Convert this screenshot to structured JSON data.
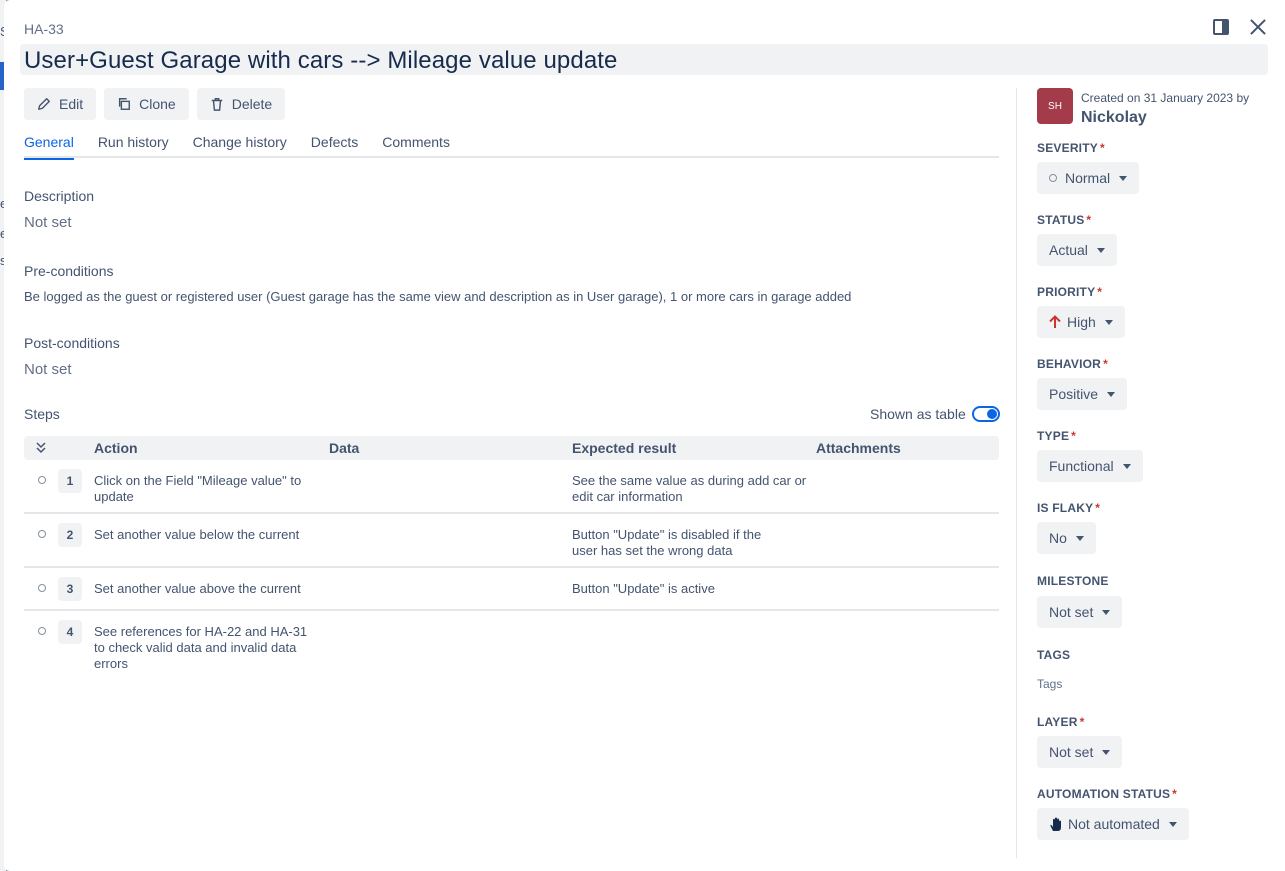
{
  "background": {
    "letters": [
      "S",
      "e",
      "e",
      "s"
    ]
  },
  "issue": {
    "key": "HA-33",
    "title": "User+Guest Garage with cars --> Mileage value update"
  },
  "toolbar": {
    "edit_label": "Edit",
    "clone_label": "Clone",
    "delete_label": "Delete"
  },
  "tabs": [
    {
      "label": "General",
      "active": true
    },
    {
      "label": "Run history",
      "active": false
    },
    {
      "label": "Change history",
      "active": false
    },
    {
      "label": "Defects",
      "active": false
    },
    {
      "label": "Comments",
      "active": false
    }
  ],
  "general": {
    "description_label": "Description",
    "description_value": "Not set",
    "preconditions_label": "Pre-conditions",
    "preconditions_value": "Be logged as the guest or registered user (Guest garage has the same view and description as in User garage), 1 or more cars in garage added",
    "postconditions_label": "Post-conditions",
    "postconditions_value": "Not set",
    "steps_label": "Steps",
    "shown_as_table_label": "Shown as table",
    "shown_as_table_on": true
  },
  "steps_table": {
    "columns": [
      "Action",
      "Data",
      "Expected result",
      "Attachments"
    ],
    "rows": [
      {
        "num": "1",
        "action": "Click on the Field \"Mileage value\" to update",
        "data": "",
        "expected": "See the same value as during add car or edit car information"
      },
      {
        "num": "2",
        "action": "Set another value below the current",
        "data": "",
        "expected": "Button \"Update\" is disabled if the user has set the wrong data"
      },
      {
        "num": "3",
        "action": "Set another value above the current",
        "data": "",
        "expected": "Button \"Update\" is active"
      },
      {
        "num": "4",
        "action": "See references for HA-22 and HA-31 to check valid data and invalid data errors",
        "data": "",
        "expected": ""
      }
    ]
  },
  "sidebar": {
    "avatar_initials": "SH",
    "created_text": "Created on 31 January 2023 by",
    "author": "Nickolay",
    "fields": {
      "severity": {
        "label": "SEVERITY",
        "value": "Normal"
      },
      "status": {
        "label": "STATUS",
        "value": "Actual"
      },
      "priority": {
        "label": "PRIORITY",
        "value": "High"
      },
      "behavior": {
        "label": "BEHAVIOR",
        "value": "Positive"
      },
      "type": {
        "label": "TYPE",
        "value": "Functional"
      },
      "is_flaky": {
        "label": "IS FLAKY",
        "value": "No"
      },
      "milestone": {
        "label": "MILESTONE",
        "value": "Not set"
      },
      "tags": {
        "label": "TAGS",
        "placeholder": "Tags"
      },
      "layer": {
        "label": "LAYER",
        "value": "Not set"
      },
      "automation_status": {
        "label": "AUTOMATION STATUS",
        "value": "Not automated"
      }
    }
  },
  "colors": {
    "accent": "#0c66e4",
    "priority_high": "#c9372c",
    "avatar": "#a33b4a",
    "required": "#c9372c"
  },
  "icons": {
    "edit": "pencil-icon",
    "clone": "copy-icon",
    "delete": "trash-icon",
    "panel": "side-panel-icon",
    "close": "close-icon",
    "priority": "arrow-up-icon",
    "automation": "hand-icon",
    "collapse": "double-chevron-down-icon"
  }
}
